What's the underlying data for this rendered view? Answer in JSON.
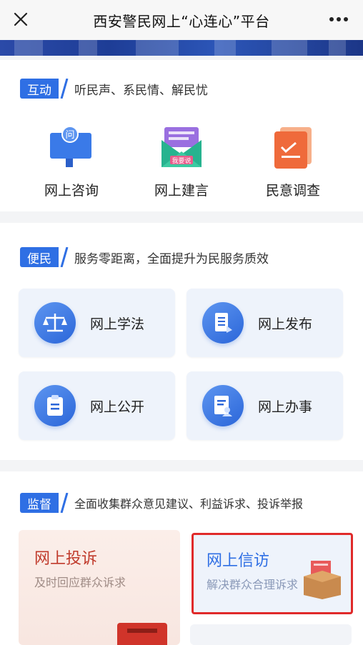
{
  "header": {
    "title": "西安警民网上“心连心”平台",
    "close_icon": "close-icon",
    "more_icon": "more-icon"
  },
  "interaction": {
    "tag": "互动",
    "desc": "听民声、系民情、解民忧",
    "items": [
      {
        "label": "网上咨询",
        "icon": "consult-icon"
      },
      {
        "label": "网上建言",
        "icon": "suggestion-icon"
      },
      {
        "label": "民意调查",
        "icon": "survey-icon"
      }
    ]
  },
  "convenience": {
    "tag": "便民",
    "desc": "服务零距离，全面提升为民服务质效",
    "items": [
      {
        "label": "网上学法",
        "icon": "scale-icon"
      },
      {
        "label": "网上发布",
        "icon": "publish-icon"
      },
      {
        "label": "网上公开",
        "icon": "clipboard-icon"
      },
      {
        "label": "网上办事",
        "icon": "document-user-icon"
      }
    ]
  },
  "supervision": {
    "tag": "监督",
    "desc": "全面收集群众意见建议、利益诉求、投诉举报",
    "items": [
      {
        "title": "网上投诉",
        "subtitle": "及时回应群众诉求"
      },
      {
        "title": "网上信访",
        "subtitle": "解决群众合理诉求"
      }
    ]
  },
  "colors": {
    "accent_blue": "#2f6fe4",
    "complaint_red": "#c03a2b",
    "highlight_border": "#e02a2a"
  }
}
